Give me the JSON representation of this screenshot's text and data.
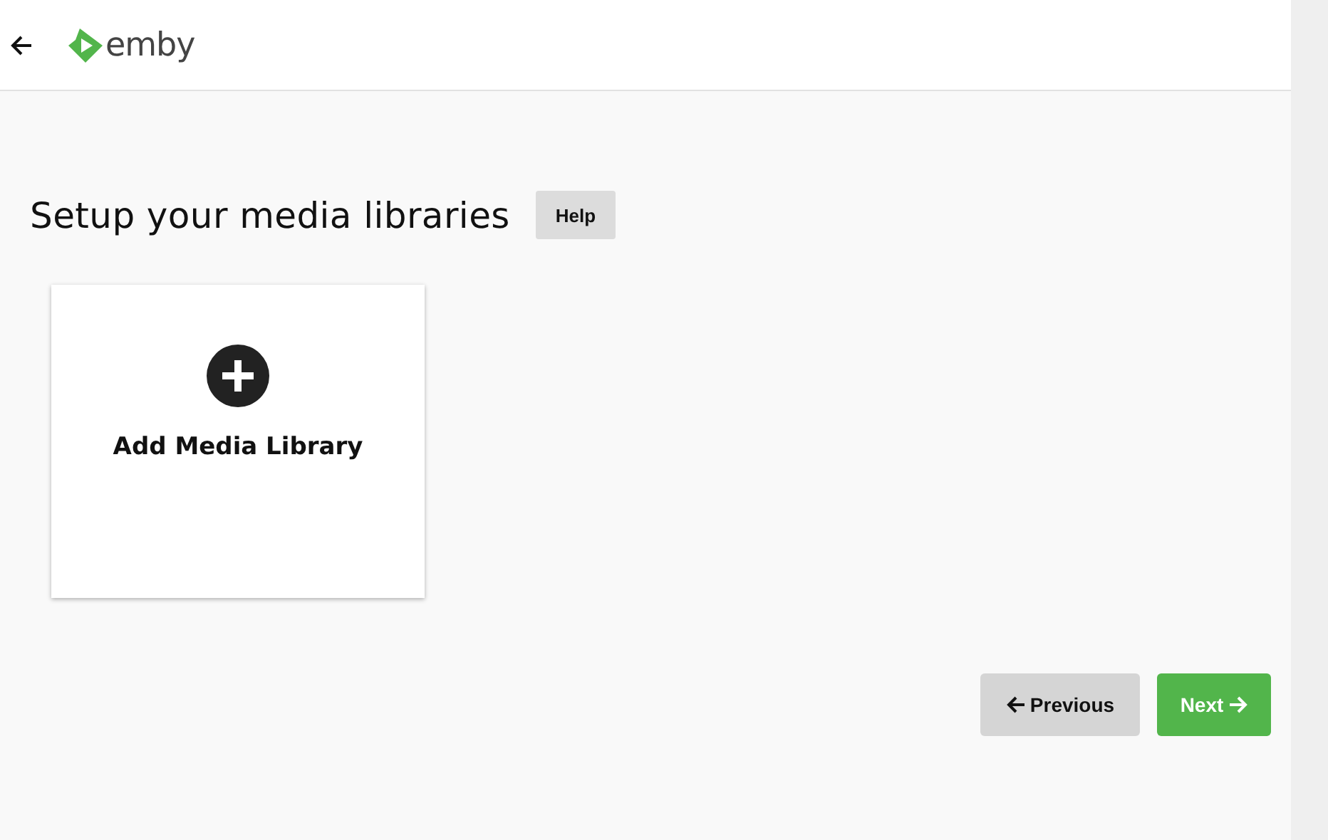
{
  "header": {
    "logo_text": "emby"
  },
  "heading": "Setup your media libraries",
  "help_button": "Help",
  "library_card": {
    "label": "Add Media Library"
  },
  "buttons": [
    {
      "kind": "previous",
      "label": "Previous"
    },
    {
      "kind": "next",
      "label": "Next"
    }
  ]
}
